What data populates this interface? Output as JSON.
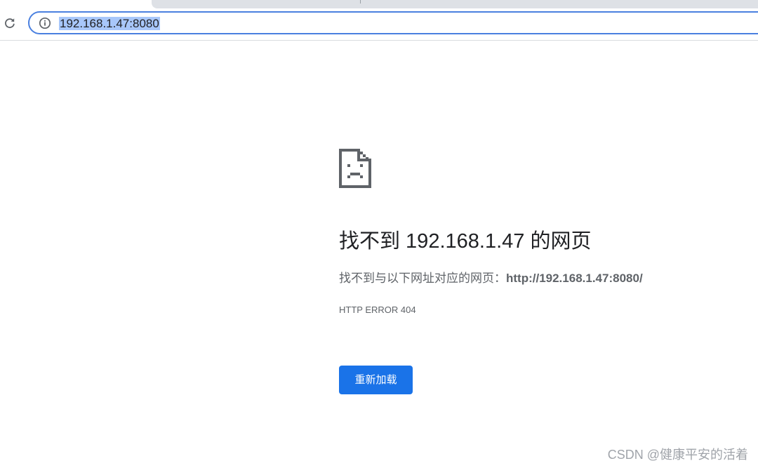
{
  "browser": {
    "url": "192.168.1.47:8080",
    "reload_icon": "reload-icon",
    "site_info_icon": "info-icon",
    "colors": {
      "omnibox_border": "#4a80e0",
      "url_selection": "#a8c7fa"
    }
  },
  "error_page": {
    "icon": "sad-page-icon",
    "title": "找不到 192.168.1.47 的网页",
    "description_prefix": "找不到与以下网址对应的网页：",
    "description_url": "http://192.168.1.47:8080/",
    "error_code": "HTTP ERROR 404",
    "reload_label": "重新加载",
    "colors": {
      "button": "#1a73e8",
      "button_text": "#ffffff"
    }
  },
  "watermark": "CSDN @健康平安的活着"
}
